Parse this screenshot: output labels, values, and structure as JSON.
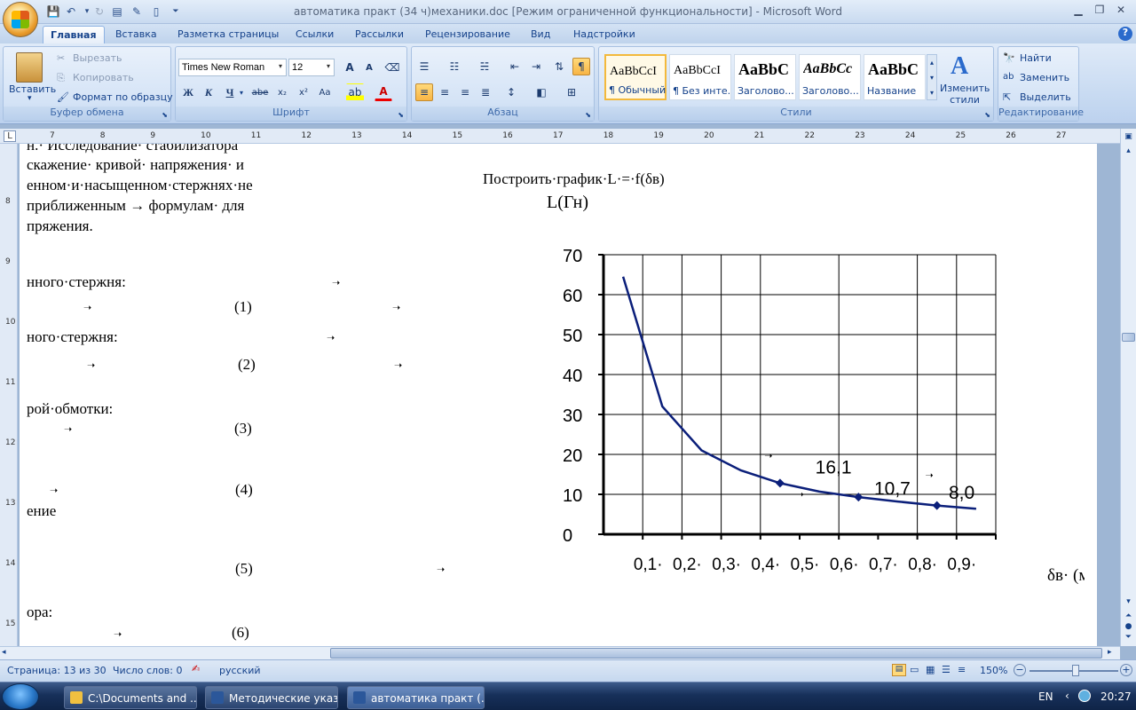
{
  "window": {
    "title": "автоматика практ (34 ч)механики.doc [Режим ограниченной функциональности] - Microsoft Word"
  },
  "tabs": [
    "Главная",
    "Вставка",
    "Разметка страницы",
    "Ссылки",
    "Рассылки",
    "Рецензирование",
    "Вид",
    "Надстройки"
  ],
  "ribbon": {
    "clipboard": {
      "paste": "Вставить",
      "cut": "Вырезать",
      "copy": "Копировать",
      "format_painter": "Формат по образцу",
      "label": "Буфер обмена"
    },
    "font": {
      "family": "Times New Roman",
      "size": "12",
      "label": "Шрифт",
      "bold": "Ж",
      "italic": "К",
      "underline": "Ч",
      "strike": "abe",
      "sub": "x₂",
      "sup": "x²",
      "case": "Aa",
      "grow": "A",
      "shrink": "A"
    },
    "paragraph": {
      "label": "Абзац"
    },
    "styles": {
      "label": "Стили",
      "items": [
        {
          "preview": "AaBbCcI",
          "name": "¶ Обычный"
        },
        {
          "preview": "AaBbCcI",
          "name": "¶ Без инте..."
        },
        {
          "preview": "AaBbC",
          "name": "Заголово..."
        },
        {
          "preview": "AaBbCc",
          "name": "Заголово..."
        },
        {
          "preview": "AaBbC",
          "name": "Название"
        }
      ],
      "change": "Изменить стили"
    },
    "editing": {
      "find": "Найти",
      "replace": "Заменить",
      "select": "Выделить",
      "label": "Редактирование"
    }
  },
  "ruler": {
    "numbers": [
      "7",
      "8",
      "9",
      "10",
      "11",
      "12",
      "13",
      "14",
      "15",
      "16",
      "17",
      "18",
      "19",
      "20",
      "21",
      "22",
      "23",
      "24",
      "25",
      "26",
      "27"
    ]
  },
  "vruler": {
    "numbers": [
      "8",
      "9",
      "10",
      "11",
      "12",
      "13",
      "14",
      "15"
    ]
  },
  "document": {
    "left_lines": [
      "скажение· кривой· напряжения· и",
      "енном·и·насыщенном·стержнях·не",
      "приближенным → формулам· для",
      "пряжения.",
      "нного·стержня:",
      "ного·стержня:",
      "рой·обмотки:",
      "ение",
      "ора:"
    ],
    "top_cut": "н.·   Исследование·   стабилизатора",
    "eq_numbers": [
      "(1)",
      "(2)",
      "(3)",
      "(4)",
      "(5)",
      "(6)"
    ],
    "heading": "Построить·график·L·=·f(δв)",
    "y_unit": "L(Гн)"
  },
  "chart_data": {
    "type": "line",
    "title": "Построить·график·L·=·f(δв)",
    "ylabel": "L(Гн)",
    "xlabel": "δв· (мм)",
    "y_ticks": [
      "0",
      "10",
      "20",
      "30",
      "40",
      "50",
      "60",
      "70"
    ],
    "x_ticks": [
      "0,1·",
      "0,2·",
      "0,3·",
      "0,4·",
      "0,5·",
      "0,6·",
      "0,7·",
      "0,8·",
      "0,9·"
    ],
    "xlim": [
      0,
      1.0
    ],
    "ylim": [
      0,
      70
    ],
    "grid": true,
    "series": [
      {
        "x": [
          0.05,
          0.15,
          0.25,
          0.35,
          0.45,
          0.55,
          0.65,
          0.75,
          0.85,
          0.95
        ],
        "y": [
          64.5,
          32,
          21,
          16,
          12.8,
          10.7,
          9.3,
          8.2,
          7.2,
          6.4
        ]
      }
    ],
    "markers_at": [
      0.45,
      0.65,
      0.85
    ],
    "annotations": [
      "16,1",
      "10,7",
      "8,0"
    ]
  },
  "status": {
    "page": "Страница: 13 из 30",
    "words": "Число слов: 0",
    "lang": "русский",
    "zoom": "150%"
  },
  "taskbar": {
    "tasks": [
      "C:\\Documents and ...",
      "Методические указ...",
      "автоматика практ (..."
    ],
    "lang": "EN",
    "time": "20:27"
  },
  "colors": {
    "accent": "#15428b",
    "chart_line": "#0b1f7a"
  }
}
